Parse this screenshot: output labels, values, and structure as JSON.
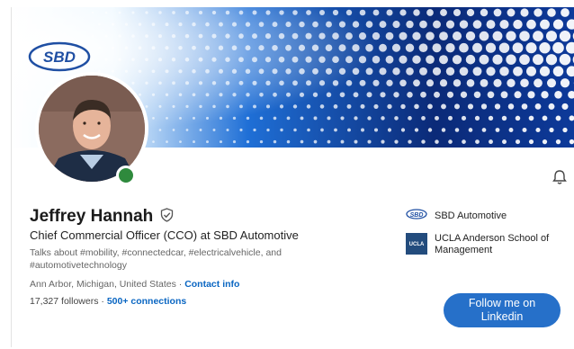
{
  "profile": {
    "name": "Jeffrey Hannah",
    "headline": "Chief Commercial Officer (CCO) at SBD Automotive",
    "about": "Talks about #mobility, #connectedcar, #electricalvehicle, and #automotivetechnology",
    "location": "Ann Arbor, Michigan, United States",
    "location_separator": " · ",
    "contact_link": "Contact info",
    "followers": "17,327 followers",
    "connections_separator": " · ",
    "connections": "500+ connections"
  },
  "banner": {
    "logo_text": "SBD",
    "colors": {
      "dark": "#0b2a78",
      "mid": "#1f6fd6",
      "light": "#e8f6ff",
      "dot": "#ffffff"
    }
  },
  "experience": [
    {
      "name": "SBD Automotive",
      "logo_text": "SBD"
    },
    {
      "name": "UCLA Anderson School of Management",
      "logo_text": "UCLA"
    }
  ],
  "cta": {
    "label": "Follow me on Linkedin",
    "color": "#2670c9"
  },
  "icons": {
    "verified": "shield-check-icon",
    "bell": "bell-icon"
  }
}
